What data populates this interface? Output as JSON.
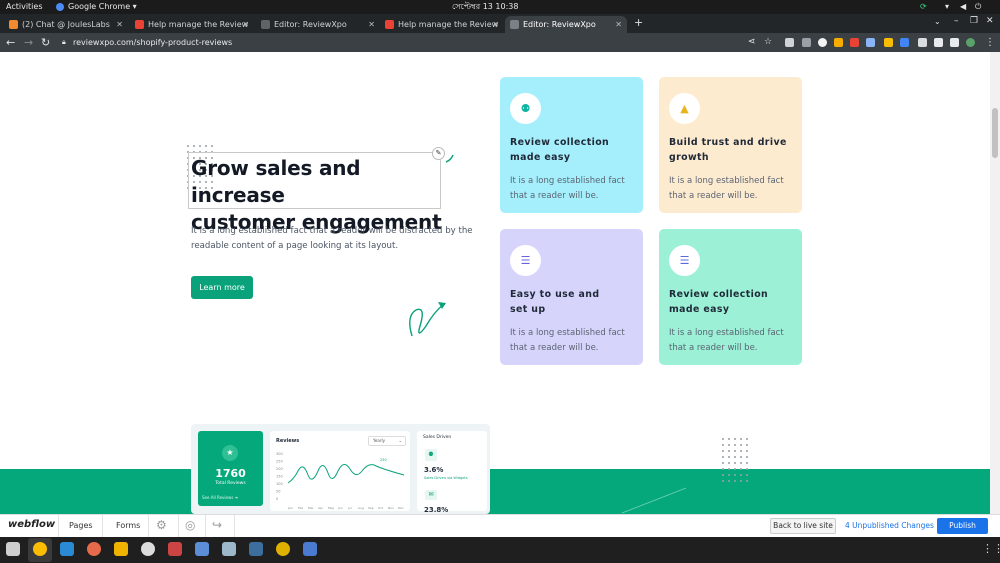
{
  "system": {
    "activities": "Activities",
    "app_name": "Google Chrome ▾",
    "datetime": "সেপ্টেম্বর 13  10:38"
  },
  "tabs": [
    {
      "label": "(2) Chat @ JoulesLabs",
      "color": "#f28b30"
    },
    {
      "label": "Help manage the Review",
      "color": "#ea4335"
    },
    {
      "label": "Editor: ReviewXpo",
      "color": "#3c4043"
    },
    {
      "label": "Help manage the Review",
      "color": "#ea4335"
    },
    {
      "label": "Editor: ReviewXpo",
      "color": "#3c4043"
    }
  ],
  "address": {
    "url": "reviewxpo.com/shopify-product-reviews"
  },
  "hero": {
    "title_line1": "Grow sales and increase",
    "title_line2": "customer engagement",
    "desc_line1": "It is a long established fact that a reader will be distracted by the",
    "desc_line2": "readable content of a page looking at its layout.",
    "button": "Learn more"
  },
  "cards": [
    {
      "title_line1": "Review collection",
      "title_line2": "made easy",
      "text_line1": "It is a long established fact",
      "text_line2": "that a reader will be.",
      "bg": "#a5eefb",
      "icon": "share-icon",
      "icon_glyph": "⚉",
      "icon_color": "#11b3a3"
    },
    {
      "title_line1": "Build trust and drive",
      "title_line2": "growth",
      "text_line1": "It is a long established fact",
      "text_line2": "that a reader will be.",
      "bg": "#fdebd0",
      "icon": "triangle-shapes-icon",
      "icon_glyph": "▲",
      "icon_color": "#e8b422"
    },
    {
      "title_line1": "Easy to use and",
      "title_line2": "set up",
      "text_line1": "It is a long established fact",
      "text_line2": "that a reader will be.",
      "bg": "#d6d4fb",
      "icon": "sliders-icon",
      "icon_glyph": "☰",
      "icon_color": "#6a63e0"
    },
    {
      "title_line1": "Review collection",
      "title_line2": "made easy",
      "text_line1": "It is a long established fact",
      "text_line2": "that a reader will be.",
      "bg": "#9bf0d6",
      "icon": "sliders-icon",
      "icon_glyph": "☰",
      "icon_color": "#5a6be0"
    }
  ],
  "dashboard": {
    "total_value": "1760",
    "total_label": "Total Reviews",
    "see_all": "See All Reviews ➔",
    "chart_title": "Reviews",
    "period": "Yearly",
    "y_ticks": [
      "300",
      "250",
      "200",
      "150",
      "100",
      "50",
      "0"
    ],
    "months": [
      "Jan",
      "Feb",
      "Mar",
      "Apr",
      "May",
      "Jun",
      "Jul",
      "Aug",
      "Sep",
      "Oct",
      "Nov",
      "Dec"
    ],
    "peak_label": "250",
    "sales_title": "Sales Driven",
    "sales_pct1": "3.6%",
    "sales_sub1": "Sales Driven via Widgets",
    "sales_pct2": "23.8%"
  },
  "webflow": {
    "logo": "webflow",
    "pages": "Pages",
    "forms": "Forms",
    "back": "Back to live site",
    "changes": "4 Unpublished Changes",
    "publish": "Publish"
  },
  "colors": {
    "accent": "#0aa27b",
    "band": "#05a87b",
    "publish": "#1a73e8"
  }
}
